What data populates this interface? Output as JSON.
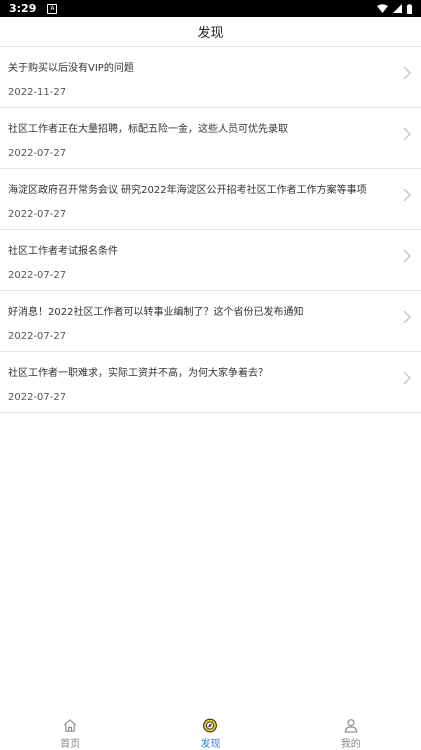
{
  "status_bar": {
    "time": "3:29",
    "notification_glyph": "A"
  },
  "header": {
    "title": "发现"
  },
  "articles": [
    {
      "title": "关于购买以后没有VIP的问题",
      "date": "2022-11-27"
    },
    {
      "title": "社区工作者正在大量招聘，标配五险一金，这些人员可优先录取",
      "date": "2022-07-27"
    },
    {
      "title": "海淀区政府召开常务会议 研究2022年海淀区公开招考社区工作者工作方案等事项",
      "date": "2022-07-27"
    },
    {
      "title": "社区工作者考试报名条件",
      "date": "2022-07-27"
    },
    {
      "title": "好消息！2022社区工作者可以转事业编制了？这个省份已发布通知",
      "date": "2022-07-27"
    },
    {
      "title": "社区工作者一职难求，实际工资并不高，为何大家争着去？",
      "date": "2022-07-27"
    }
  ],
  "tabbar": {
    "tabs": [
      {
        "label": "首页",
        "icon": "home-icon"
      },
      {
        "label": "发现",
        "icon": "discover-icon"
      },
      {
        "label": "我的",
        "icon": "user-icon"
      }
    ],
    "active_index": 1
  },
  "colors": {
    "accent": "#2f7ddb",
    "active_icon_fill": "#f5c518",
    "divider": "#e6e6e6",
    "status_bar_bg": "#000000"
  }
}
